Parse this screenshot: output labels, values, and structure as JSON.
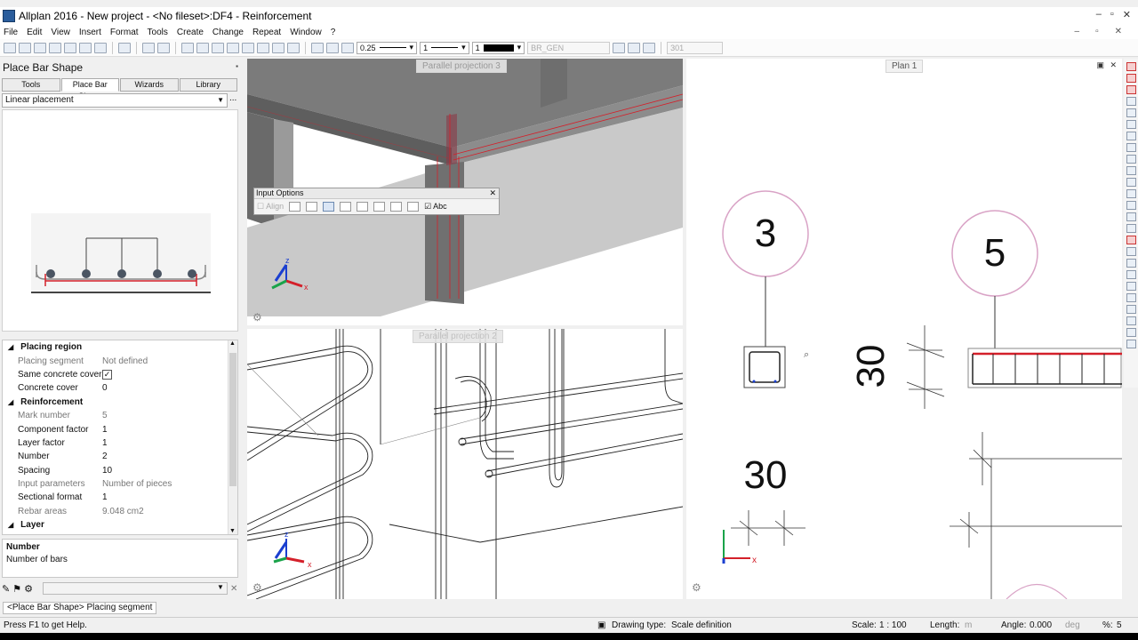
{
  "window": {
    "title": "Allplan 2016 - New project - <No fileset>:DF4 - Reinforcement",
    "controls": [
      "–",
      "▫",
      "✕"
    ]
  },
  "menu": {
    "items": [
      "File",
      "Edit",
      "View",
      "Insert",
      "Format",
      "Tools",
      "Create",
      "Change",
      "Repeat",
      "Window",
      "?"
    ],
    "mdi": [
      "–",
      "▫",
      "✕"
    ]
  },
  "toolbar": {
    "pen": "0.25",
    "line": "1",
    "color": "1",
    "layer": "BR_GEN",
    "extra": "301"
  },
  "left_panel": {
    "title": "Place Bar Shape",
    "tabs": [
      "Tools",
      "Place Bar Shape",
      "Wizards",
      "Library"
    ],
    "active_tab": 1,
    "mode": "Linear placement",
    "more": "...",
    "properties": {
      "placing_region": {
        "title": "Placing region",
        "placing_segment_label": "Placing segment",
        "placing_segment": "Not defined",
        "same_cover_label": "Same concrete cover",
        "same_cover_check": "✓",
        "cover_label": "Concrete cover",
        "cover": "0"
      },
      "reinforcement": {
        "title": "Reinforcement",
        "mark_label": "Mark number",
        "mark": "5",
        "component_label": "Component factor",
        "component": "1",
        "layer_factor_label": "Layer factor",
        "layer_factor": "1",
        "number_label": "Number",
        "number": "2",
        "spacing_label": "Spacing",
        "spacing": "10",
        "input_label": "Input parameters",
        "input": "Number of pieces",
        "sectional_label": "Sectional format",
        "sectional": "1",
        "rebar_label": "Rebar areas",
        "rebar": "9.048 cm2"
      },
      "layer": {
        "title": "Layer"
      }
    },
    "description": {
      "title": "Number",
      "text": "Number of bars"
    }
  },
  "input_options": {
    "title": "Input Options",
    "align": "Align",
    "abc": "Abc"
  },
  "viewports": {
    "v1": {
      "label": "Parallel projection 3"
    },
    "v2": {
      "label": "Parallel projection 2"
    },
    "plan": {
      "label": "Plan 1",
      "marks": [
        "3",
        "5"
      ],
      "dims": [
        "30",
        "30"
      ]
    }
  },
  "status": {
    "prompt": "<Place Bar Shape> Placing segment",
    "help": "Press F1 to get Help.",
    "drawing_type_label": "Drawing type:",
    "drawing_type": "Scale definition",
    "scale_label": "Scale:",
    "scale": "1 : 100",
    "length_label": "Length:",
    "length_unit": "m",
    "angle_label": "Angle:",
    "angle": "0.000",
    "angle_unit": "deg",
    "percent_label": "%:",
    "percent": "5"
  },
  "colors": {
    "accent_red": "#d4202a",
    "mark_circle": "#d9a3c6",
    "axis_blue": "#1b3fd0"
  }
}
